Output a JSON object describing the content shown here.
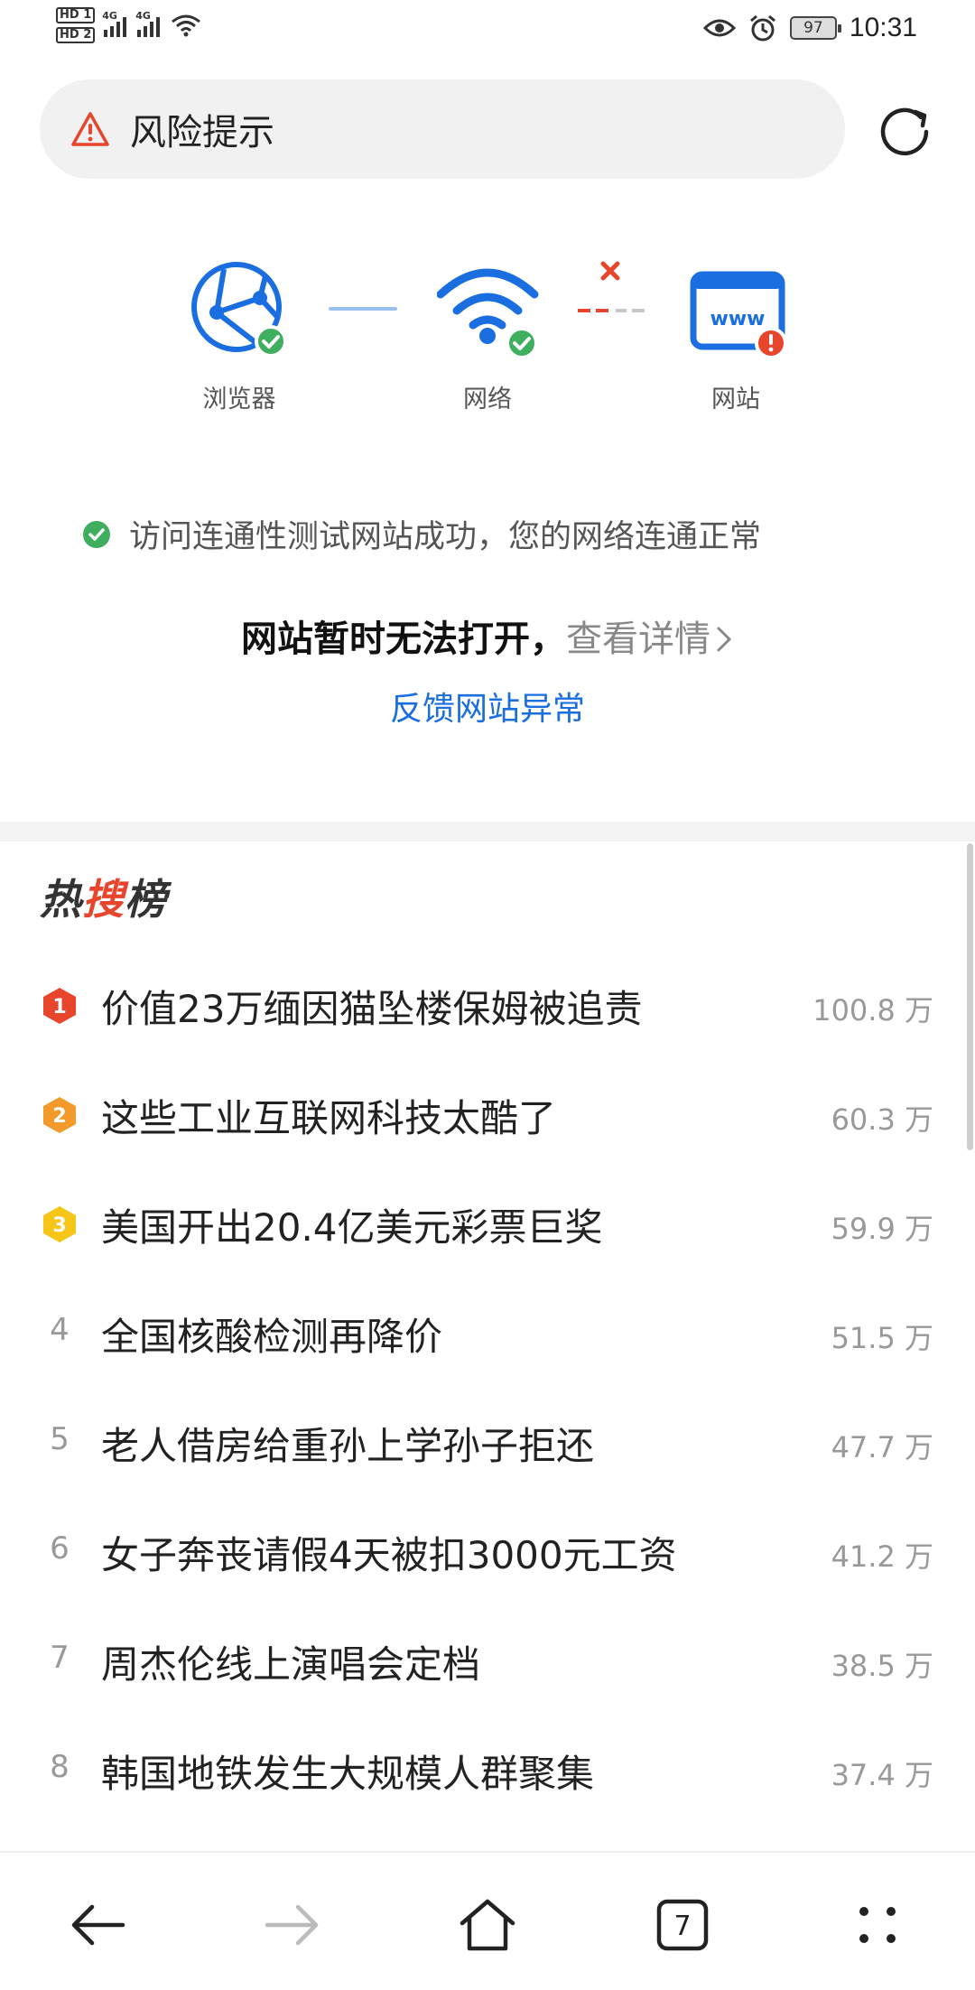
{
  "status_bar": {
    "sim1_label": "HD 1",
    "sim2_label": "HD 2",
    "net1": "4G",
    "net2": "4G",
    "battery": "97",
    "time": "10:31"
  },
  "address_bar": {
    "text": "风险提示",
    "warning_color": "#e8452d"
  },
  "diagnostic": {
    "browser_label": "浏览器",
    "network_label": "网络",
    "website_label": "网站",
    "accent_color": "#1a6ee0",
    "ok_color": "#3fae5f",
    "error_color": "#e8452d",
    "success_message": "访问连通性测试网站成功，您的网络连通正常",
    "headline_main": "网站暂时无法打开，",
    "headline_detail": "查看详情",
    "feedback_link": "反馈网站异常"
  },
  "hot_search": {
    "title_part1": "热",
    "title_part2": "搜",
    "title_part3": "榜",
    "items": [
      {
        "rank": "1",
        "text": "价值23万缅因猫坠楼保姆被追责",
        "count": "100.8 万",
        "badge_color": "#e8452d"
      },
      {
        "rank": "2",
        "text": "这些工业互联网科技太酷了",
        "count": "60.3 万",
        "badge_color": "#f29b2c"
      },
      {
        "rank": "3",
        "text": "美国开出20.4亿美元彩票巨奖",
        "count": "59.9 万",
        "badge_color": "#f5c518"
      },
      {
        "rank": "4",
        "text": "全国核酸检测再降价",
        "count": "51.5 万"
      },
      {
        "rank": "5",
        "text": "老人借房给重孙上学孙子拒还",
        "count": "47.7 万"
      },
      {
        "rank": "6",
        "text": "女子奔丧请假4天被扣3000元工资",
        "count": "41.2 万"
      },
      {
        "rank": "7",
        "text": "周杰伦线上演唱会定档",
        "count": "38.5 万"
      },
      {
        "rank": "8",
        "text": "韩国地铁发生大规模人群聚集",
        "count": "37.4 万"
      }
    ]
  },
  "bottom_nav": {
    "tab_count": "7",
    "icons": [
      "back-icon",
      "forward-icon",
      "home-icon",
      "tabs-icon",
      "menu-icon"
    ]
  }
}
